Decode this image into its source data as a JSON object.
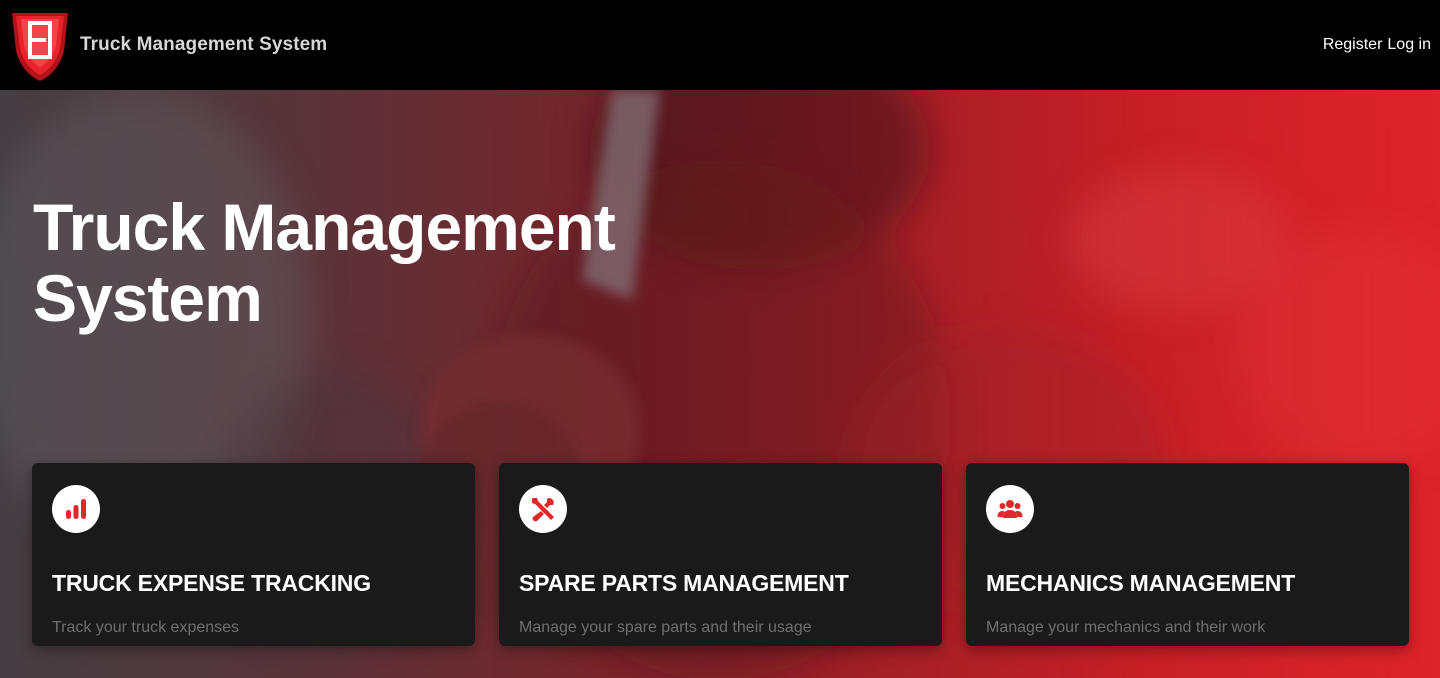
{
  "header": {
    "brand_name": "Truck Management System",
    "logo_icon": "red-shield-e-logo",
    "links": [
      "Register",
      "Log in"
    ]
  },
  "hero": {
    "title_line1": "Truck Management",
    "title_line2": "System"
  },
  "features": [
    {
      "icon": "bar-chart-icon",
      "title": "TRUCK EXPENSE TRACKING",
      "description": "Track your truck expenses"
    },
    {
      "icon": "tools-icon",
      "title": "SPARE PARTS MANAGEMENT",
      "description": "Manage your spare parts and their usage"
    },
    {
      "icon": "people-icon",
      "title": "MECHANICS MANAGEMENT",
      "description": "Manage your mechanics and their work"
    }
  ],
  "colors": {
    "accent": "#e3262b",
    "card_bg": "#1b1a1b",
    "navbar_bg": "#000000"
  }
}
